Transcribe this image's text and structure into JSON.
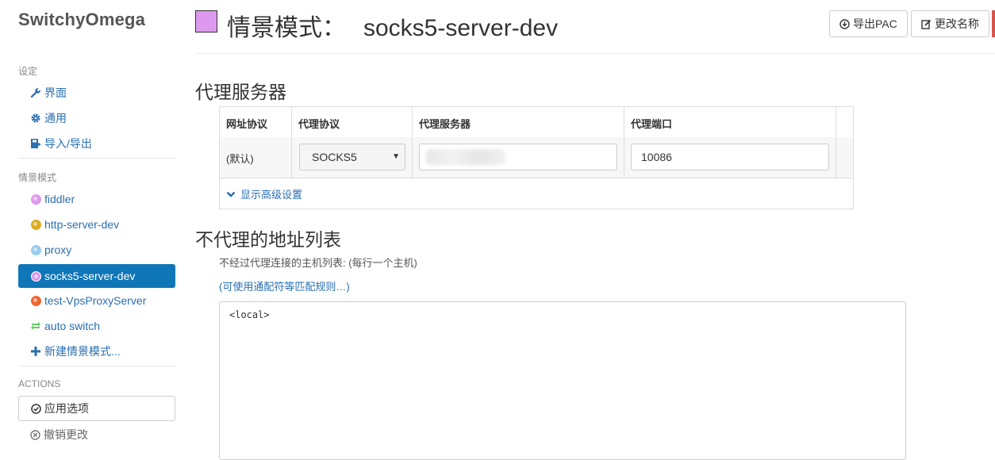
{
  "app": {
    "brand": "SwitchyOmega"
  },
  "sidebar": {
    "settings_header": "设定",
    "settings_items": [
      {
        "label": "界面",
        "icon": "wrench-icon"
      },
      {
        "label": "通用",
        "icon": "gear-icon"
      },
      {
        "label": "导入/导出",
        "icon": "import-export-icon"
      }
    ],
    "profiles_header": "情景模式",
    "profiles": [
      {
        "label": "fiddler",
        "color": "#dd99ee",
        "icon": "globe-icon"
      },
      {
        "label": "http-server-dev",
        "color": "#ddaa22",
        "icon": "globe-icon"
      },
      {
        "label": "proxy",
        "color": "#99ccee",
        "icon": "globe-icon"
      },
      {
        "label": "socks5-server-dev",
        "color": "#dd99ee",
        "icon": "globe-icon",
        "active": true
      },
      {
        "label": "test-VpsProxyServer",
        "color": "#ee6633",
        "icon": "globe-icon"
      },
      {
        "label": "auto switch",
        "color": "#66cc66",
        "icon": "switch-icon"
      },
      {
        "label": "新建情景模式...",
        "icon": "plus-icon"
      }
    ],
    "actions_header": "ACTIONS",
    "apply_label": "应用选项",
    "undo_label": "撤销更改"
  },
  "header": {
    "title_prefix": "情景模式：",
    "profile_name": "socks5-server-dev",
    "profile_color": "#dd99ee",
    "export_pac_label": "导出PAC",
    "rename_label": "更改名称"
  },
  "proxy_section": {
    "heading": "代理服务器",
    "columns": [
      "网址协议",
      "代理协议",
      "代理服务器",
      "代理端口"
    ],
    "row": {
      "scheme": "(默认)",
      "protocol": "SOCKS5",
      "server": "",
      "port": "10086"
    },
    "advanced_label": "显示高级设置"
  },
  "bypass_section": {
    "heading": "不代理的地址列表",
    "note": "不经过代理连接的主机列表: (每行一个主机)",
    "wildcard_link": "(可使用通配符等匹配规则…)",
    "list_value": "<local>"
  }
}
